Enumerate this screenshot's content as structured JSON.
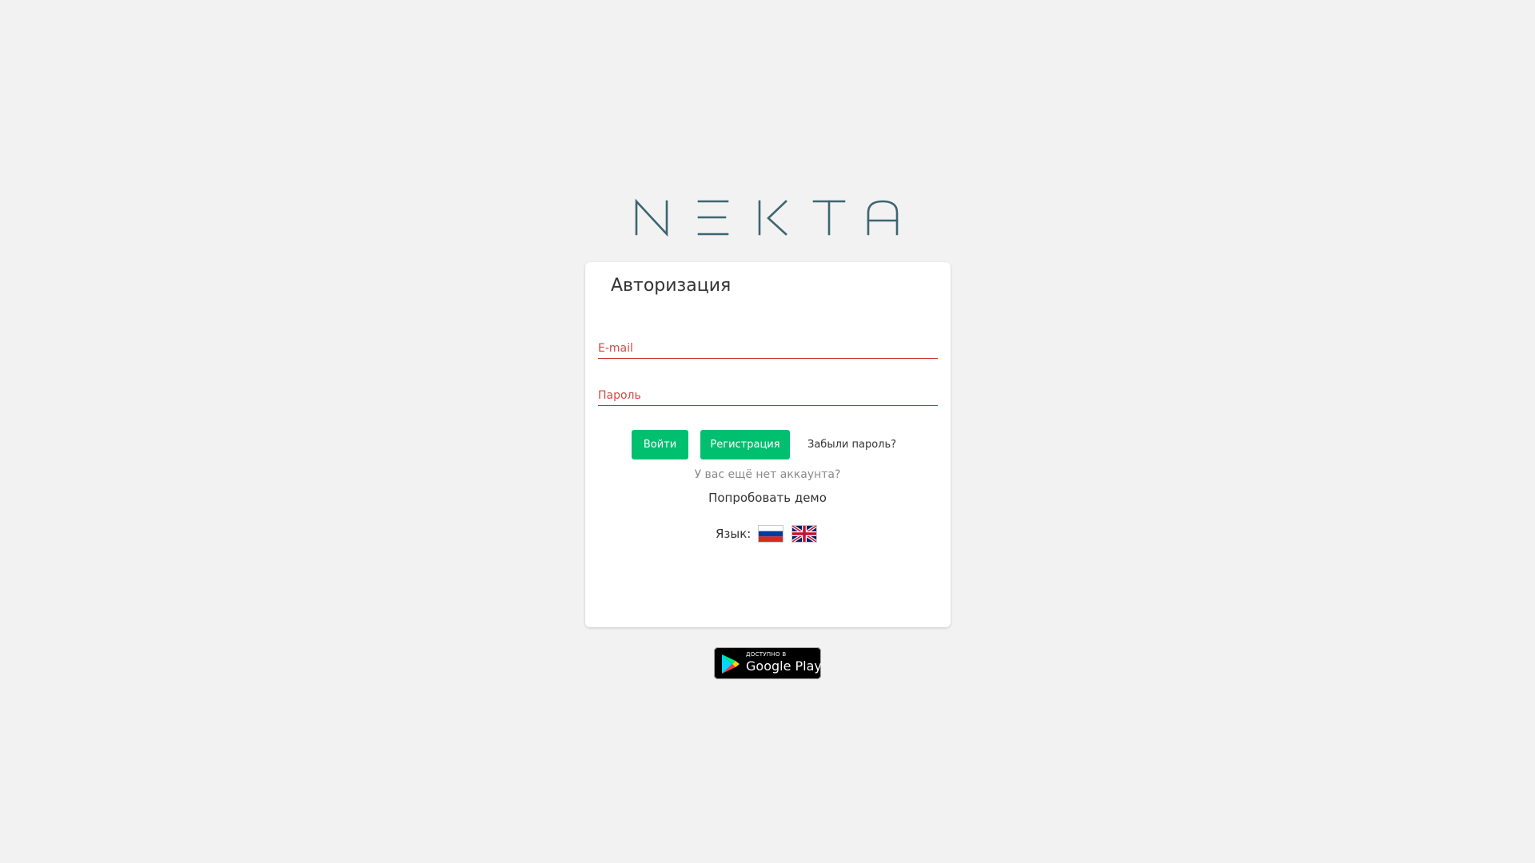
{
  "brand": {
    "logo_text": "NEKTA",
    "logo_color": "#3d6570"
  },
  "login_card": {
    "title": "Авторизация",
    "email_placeholder": "E-mail",
    "password_placeholder": "Пароль",
    "login_label": "Войти",
    "register_label": "Регистрация",
    "forgot_password_label": "Забыли пароль?",
    "no_account_text": "У вас ещё нет аккаунта?",
    "try_demo_label": "Попробовать демо",
    "language_label": "Язык:",
    "languages": [
      {
        "code": "ru",
        "icon": "russia-flag-icon"
      },
      {
        "code": "en",
        "icon": "uk-flag-icon"
      }
    ]
  },
  "store_badge": {
    "small_text": "ДОСТУПНО В",
    "big_text": "Google Play"
  },
  "colors": {
    "accent_green": "#00bf6f",
    "error_red": "#cf4a45",
    "background": "#f2f2f2"
  }
}
